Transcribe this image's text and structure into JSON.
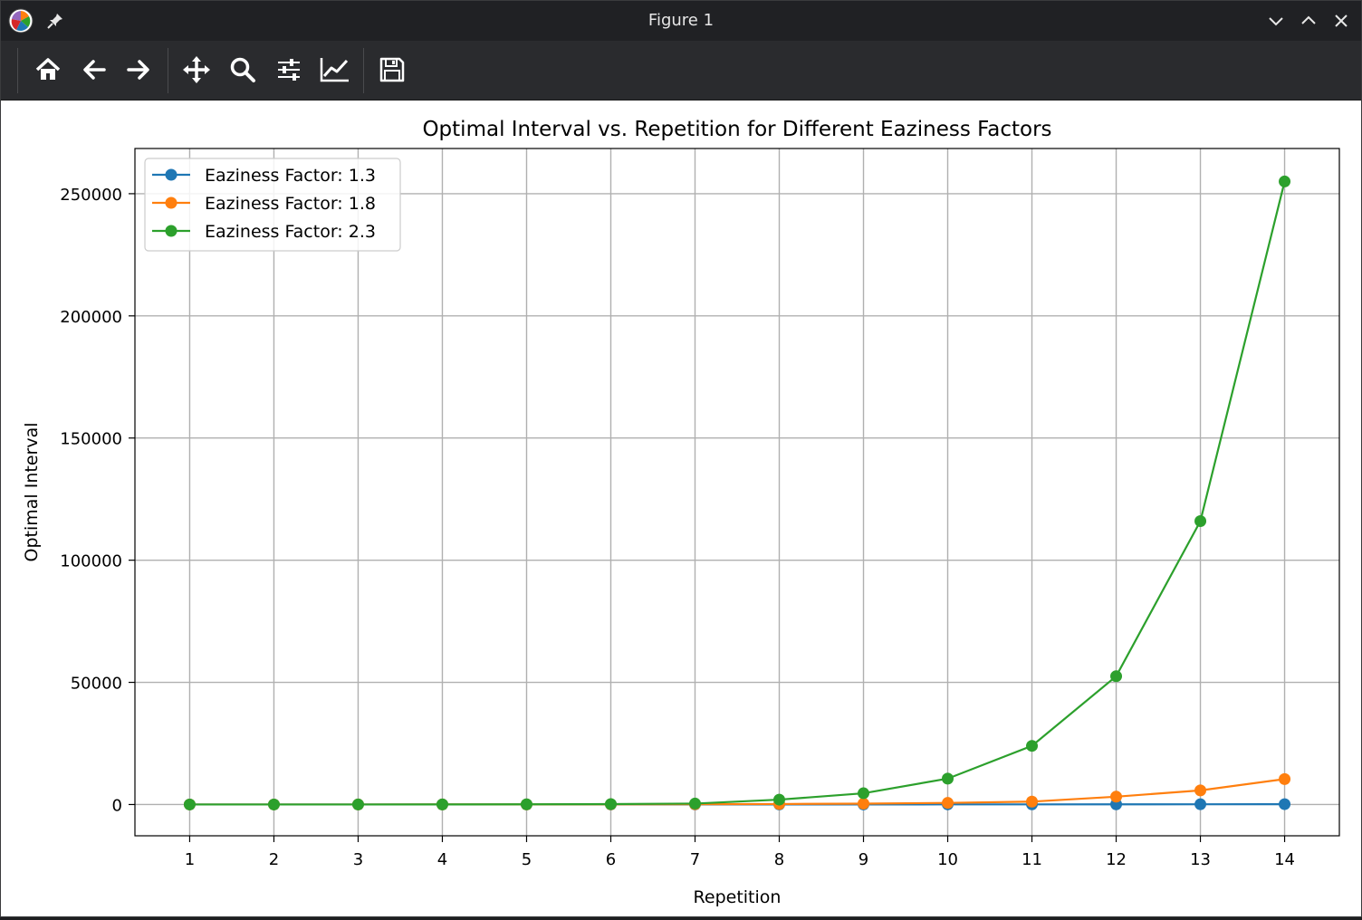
{
  "window": {
    "title": "Figure 1",
    "icons": {
      "app": "matplotlib-logo-icon",
      "pin": "pin-icon",
      "minimize": "chevron-down-icon",
      "maximize": "chevron-up-icon",
      "close": "close-icon"
    }
  },
  "toolbar": {
    "tools": [
      {
        "name": "home-icon"
      },
      {
        "name": "back-arrow-icon"
      },
      {
        "name": "forward-arrow-icon"
      },
      {
        "name": "pan-move-icon"
      },
      {
        "name": "zoom-magnifier-icon"
      },
      {
        "name": "subplots-sliders-icon"
      },
      {
        "name": "edit-axis-line-icon"
      },
      {
        "name": "save-floppy-icon"
      }
    ]
  },
  "colors": {
    "series_blue": "#1f77b4",
    "series_orange": "#ff7f0e",
    "series_green": "#2ca02c",
    "grid": "#b0b0b0"
  },
  "chart_data": {
    "type": "line",
    "title": "Optimal Interval vs. Repetition for Different Eaziness Factors",
    "xlabel": "Repetition",
    "ylabel": "Optimal Interval",
    "x": [
      1,
      2,
      3,
      4,
      5,
      6,
      7,
      8,
      9,
      10,
      11,
      12,
      13,
      14
    ],
    "xticks": [
      "1",
      "2",
      "3",
      "4",
      "5",
      "6",
      "7",
      "8",
      "9",
      "10",
      "11",
      "12",
      "13",
      "14"
    ],
    "yticks": [
      "0",
      "50000",
      "100000",
      "150000",
      "200000",
      "250000"
    ],
    "ytick_values": [
      0,
      50000,
      100000,
      150000,
      200000,
      250000
    ],
    "xlim": [
      0.35,
      14.65
    ],
    "ylim": [
      -12800,
      268500
    ],
    "grid": true,
    "legend_position": "upper-left",
    "series": [
      {
        "name": "Eaziness Factor: 1.3",
        "color": "#1f77b4",
        "marker": "circle",
        "values": [
          1,
          6,
          8,
          10,
          13,
          17,
          22,
          28,
          37,
          48,
          63,
          81,
          106,
          138
        ]
      },
      {
        "name": "Eaziness Factor: 1.8",
        "color": "#ff7f0e",
        "marker": "circle",
        "values": [
          1,
          6,
          11,
          19,
          35,
          63,
          113,
          204,
          367,
          661,
          1190,
          3212,
          5782,
          10408
        ]
      },
      {
        "name": "Eaziness Factor: 2.3",
        "color": "#2ca02c",
        "marker": "circle",
        "values": [
          1,
          6,
          14,
          32,
          73,
          167,
          384,
          2000,
          4600,
          10600,
          24000,
          52500,
          116000,
          255000
        ]
      }
    ]
  }
}
